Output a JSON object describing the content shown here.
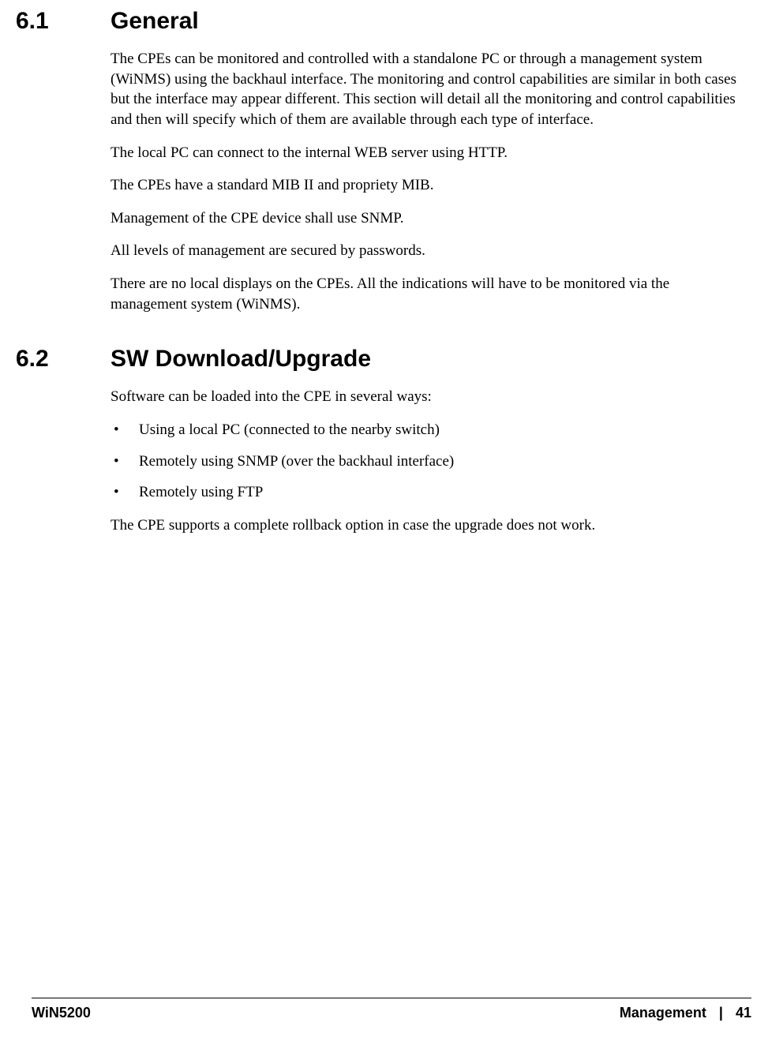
{
  "sections": [
    {
      "number": "6.1",
      "title": "General",
      "paragraphs": [
        "The CPEs can be monitored and controlled with a standalone PC or through a management system (WiNMS) using the backhaul interface. The monitoring and control capabilities are similar in both cases but the interface may appear different. This section will detail all the monitoring and control capabilities and then will specify which of them are available through each type of interface.",
        "The local PC can connect to the internal WEB server using HTTP.",
        "The CPEs have a standard MIB II and propriety MIB.",
        "Management of the CPE device shall use SNMP.",
        "All levels of management are secured by passwords.",
        "There are no local displays on the CPEs. All the indications will have to be monitored via the management system (WiNMS)."
      ]
    },
    {
      "number": "6.2",
      "title": "SW Download/Upgrade",
      "intro": "Software can be loaded into the CPE in several ways:",
      "bullets": [
        "Using a local PC (connected to the nearby switch)",
        "Remotely using SNMP (over the backhaul interface)",
        "Remotely using FTP"
      ],
      "outro": "The CPE supports a complete rollback option in case the upgrade does not work."
    }
  ],
  "footer": {
    "left": "WiN5200",
    "right_label": "Management",
    "separator": "|",
    "page": "41"
  }
}
